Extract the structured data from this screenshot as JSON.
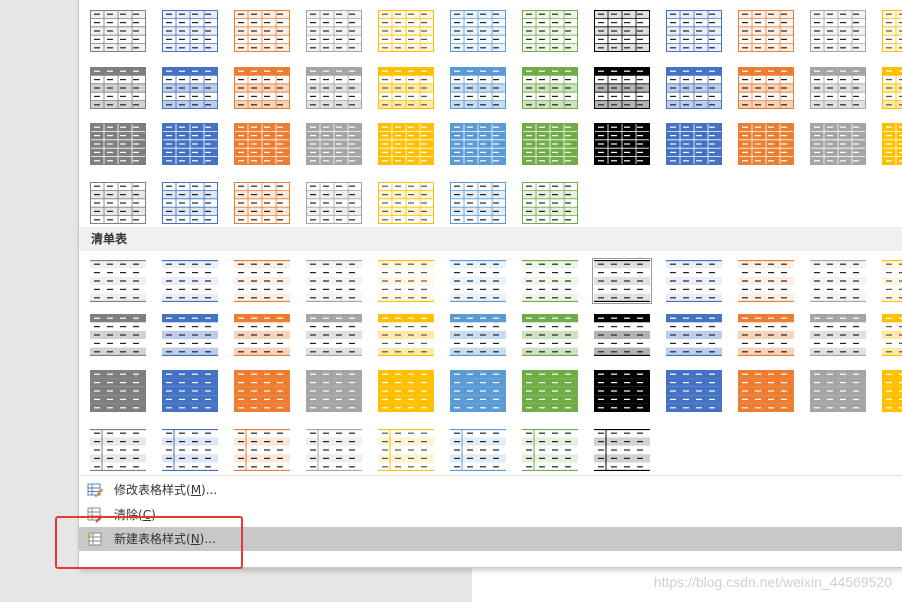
{
  "section_list": {
    "title": "清单表"
  },
  "grid_palette": [
    "#7f7f7f",
    "#4472c4",
    "#ed7d31",
    "#a5a5a5",
    "#ffc000",
    "#5b9bd5",
    "#70ad47",
    "#000000",
    "#4472c4",
    "#ed7d31",
    "#a5a5a5",
    "#ffc000"
  ],
  "grid_rows": [
    {
      "style": "plain"
    },
    {
      "style": "header"
    },
    {
      "style": "banded-dark"
    },
    {
      "style": "light-col"
    }
  ],
  "list_rows": [
    {
      "style": "list-light"
    },
    {
      "style": "list-header"
    },
    {
      "style": "list-dark"
    },
    {
      "style": "list-col"
    }
  ],
  "menu": {
    "items": [
      {
        "label": "修改表格样式(",
        "mnemonic": "M",
        "suffix": ")...",
        "icon": "table-edit-icon"
      },
      {
        "label": "清除(",
        "mnemonic": "C",
        "suffix": ")",
        "icon": "table-clear-icon"
      },
      {
        "label": "新建表格样式(",
        "mnemonic": "N",
        "suffix": ")...",
        "icon": "new-table-style-icon"
      }
    ]
  },
  "watermark": "https://blog.csdn.net/weixin_44569520"
}
